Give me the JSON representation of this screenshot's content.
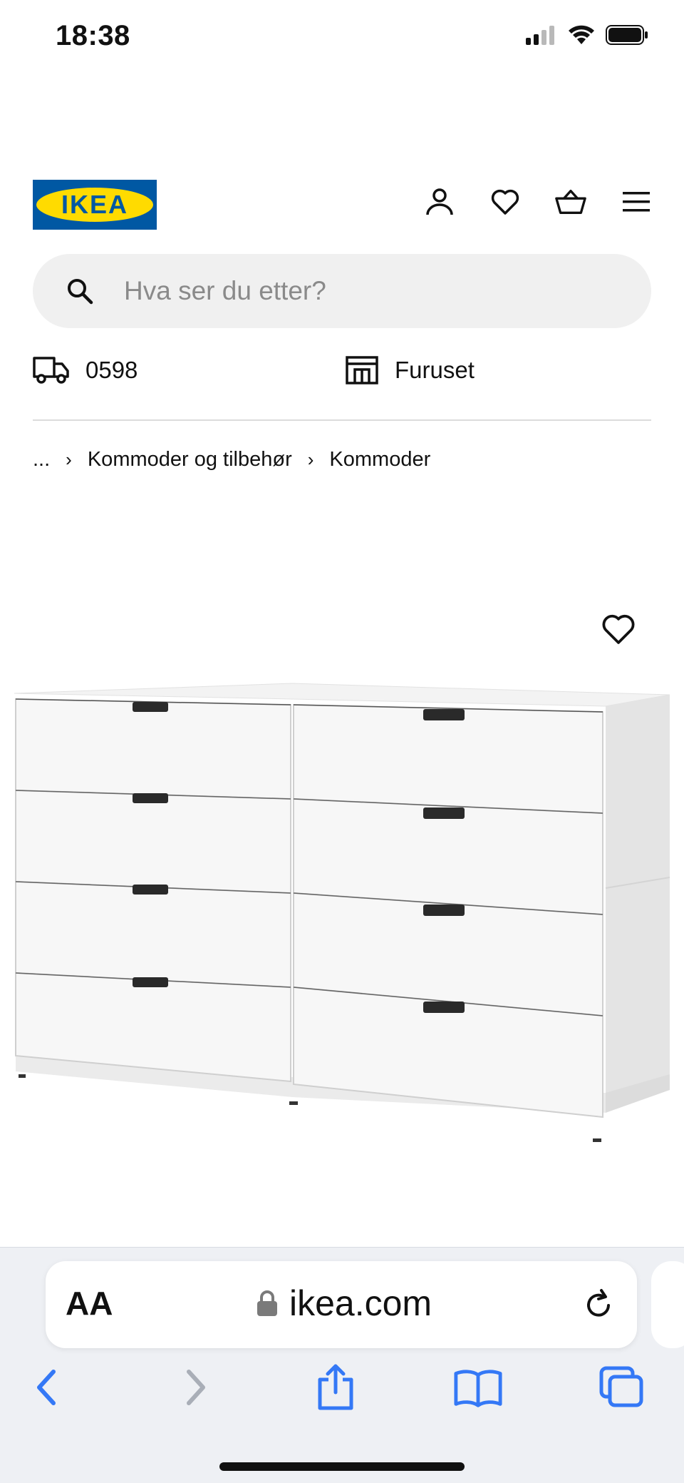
{
  "status_bar": {
    "time": "18:38"
  },
  "header": {
    "logo_text": "IKEA",
    "icons": [
      "user-icon",
      "heart-icon",
      "basket-icon",
      "menu-icon"
    ]
  },
  "search": {
    "placeholder": "Hva ser du etter?"
  },
  "delivery": {
    "postal_code": "0598",
    "store": "Furuset"
  },
  "breadcrumb": {
    "ellipsis": "...",
    "items": [
      "Kommoder og tilbehør",
      "Kommoder"
    ]
  },
  "browser": {
    "aa_label": "AA",
    "url": "ikea.com"
  },
  "colors": {
    "ikea_blue": "#0058a3",
    "ikea_yellow": "#ffdb00",
    "search_bg": "#f0f0f0",
    "browser_blue": "#3478f6"
  }
}
